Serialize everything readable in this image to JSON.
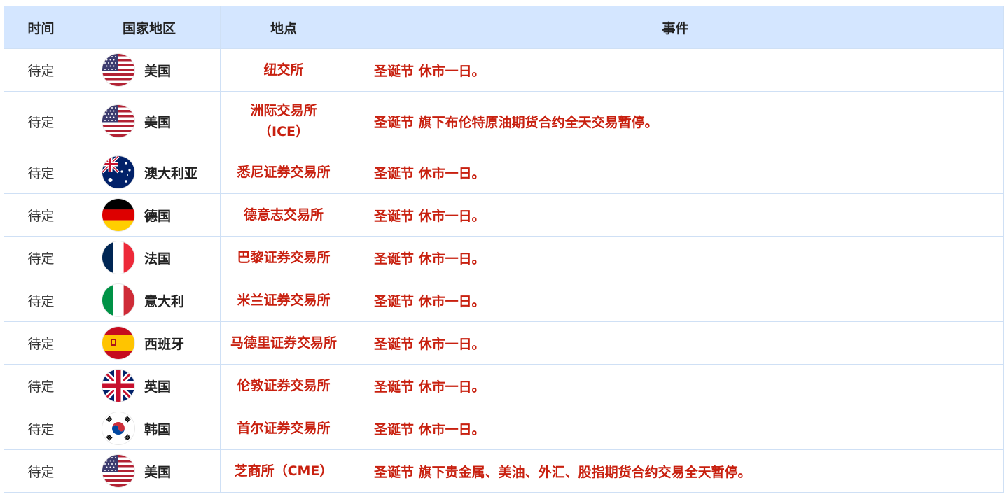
{
  "headers": {
    "time": "时间",
    "country": "国家地区",
    "place": "地点",
    "event": "事件"
  },
  "rows": [
    {
      "time": "待定",
      "flag": "us-flag",
      "country": "美国",
      "place": "纽交所",
      "event": "圣诞节 休市一日。"
    },
    {
      "time": "待定",
      "flag": "us-flag",
      "country": "美国",
      "place": "洲际交易所（ICE）",
      "event": "圣诞节 旗下布伦特原油期货合约全天交易暂停。"
    },
    {
      "time": "待定",
      "flag": "au-flag",
      "country": "澳大利亚",
      "place": "悉尼证券交易所",
      "event": "圣诞节 休市一日。"
    },
    {
      "time": "待定",
      "flag": "de-flag",
      "country": "德国",
      "place": "德意志交易所",
      "event": "圣诞节 休市一日。"
    },
    {
      "time": "待定",
      "flag": "fr-flag",
      "country": "法国",
      "place": "巴黎证券交易所",
      "event": "圣诞节 休市一日。"
    },
    {
      "time": "待定",
      "flag": "it-flag",
      "country": "意大利",
      "place": "米兰证券交易所",
      "event": "圣诞节 休市一日。"
    },
    {
      "time": "待定",
      "flag": "es-flag",
      "country": "西班牙",
      "place": "马德里证券交易所",
      "event": "圣诞节 休市一日。"
    },
    {
      "time": "待定",
      "flag": "gb-flag",
      "country": "英国",
      "place": "伦敦证券交易所",
      "event": "圣诞节 休市一日。"
    },
    {
      "time": "待定",
      "flag": "kr-flag",
      "country": "韩国",
      "place": "首尔证券交易所",
      "event": "圣诞节 休市一日。"
    },
    {
      "time": "待定",
      "flag": "us-flag",
      "country": "美国",
      "place": "芝商所（CME）",
      "event": "圣诞节 旗下贵金属、美油、外汇、股指期货合约交易全天暂停。"
    }
  ],
  "colors": {
    "header_bg": "#d4e6ff",
    "border": "#cfe0f5",
    "accent_red": "#c8200f"
  }
}
